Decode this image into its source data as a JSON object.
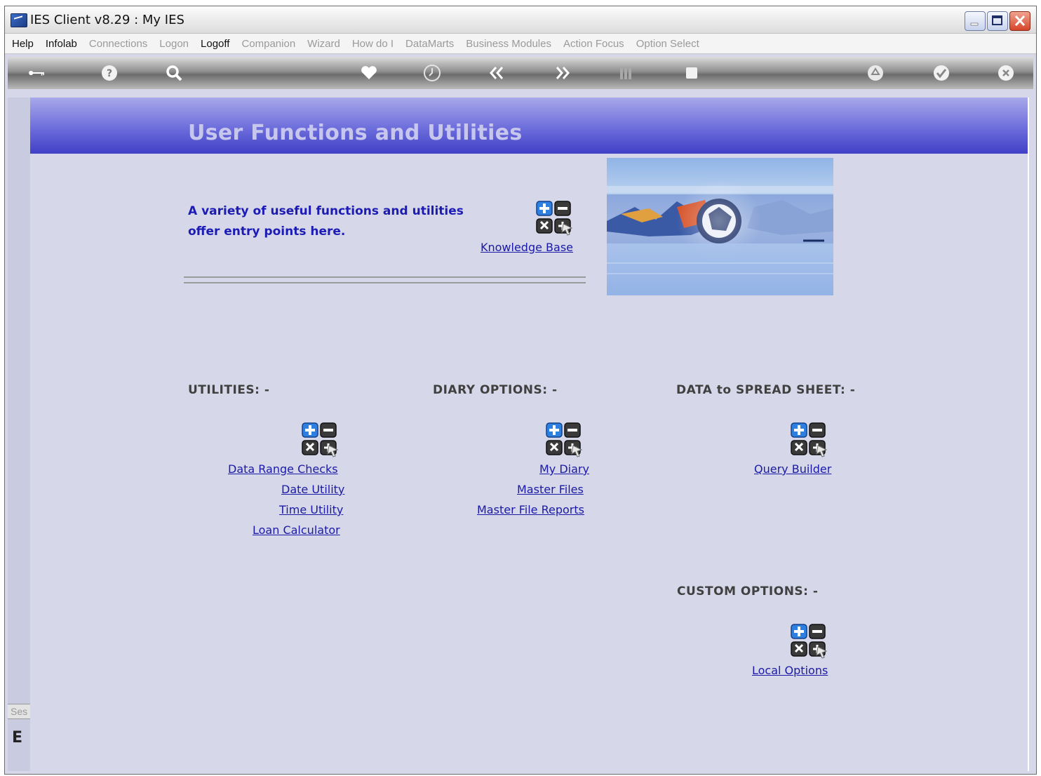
{
  "window": {
    "title": "IES Client v8.29 : My IES"
  },
  "menu": [
    {
      "label": "Help",
      "enabled": true
    },
    {
      "label": "Infolab",
      "enabled": true
    },
    {
      "label": "Connections",
      "enabled": false
    },
    {
      "label": "Logon",
      "enabled": false
    },
    {
      "label": "Logoff",
      "enabled": true
    },
    {
      "label": "Companion",
      "enabled": false
    },
    {
      "label": "Wizard",
      "enabled": false
    },
    {
      "label": "How do I",
      "enabled": false
    },
    {
      "label": "DataMarts",
      "enabled": false
    },
    {
      "label": "Business Modules",
      "enabled": false
    },
    {
      "label": "Action Focus",
      "enabled": false
    },
    {
      "label": "Option Select",
      "enabled": false
    }
  ],
  "toolbar": {
    "icons": [
      "key-icon",
      "help-icon",
      "search-icon",
      "heart-icon",
      "clock-icon",
      "back-icon",
      "forward-icon",
      "columns-icon",
      "stop-icon",
      "recycle-icon",
      "check-icon",
      "close-icon"
    ]
  },
  "sidebar": {
    "tab_label": "Ses",
    "glyph": "E"
  },
  "page": {
    "title": "User Functions and Utilities",
    "intro_line1": "A variety of useful functions and utilities",
    "intro_line2": "offer entry points here.",
    "knowledge_base": "Knowledge Base"
  },
  "sections": {
    "utilities": {
      "title": "UTILITIES: -",
      "links": [
        "Data Range Checks",
        "Date Utility",
        "Time Utility",
        "Loan Calculator"
      ]
    },
    "diary": {
      "title": "DIARY OPTIONS: -",
      "links": [
        "My Diary",
        "Master Files",
        "Master File Reports"
      ]
    },
    "spreadsheet": {
      "title": "DATA to SPREAD SHEET: -",
      "links": [
        "Query Builder"
      ]
    },
    "custom": {
      "title": "CUSTOM OPTIONS: -",
      "links": [
        "Local Options"
      ]
    }
  },
  "colors": {
    "header_band": "#4040c6",
    "link": "#1a1aa6",
    "intro_text": "#1c1cb4",
    "panel_bg": "#d6d7e9"
  }
}
